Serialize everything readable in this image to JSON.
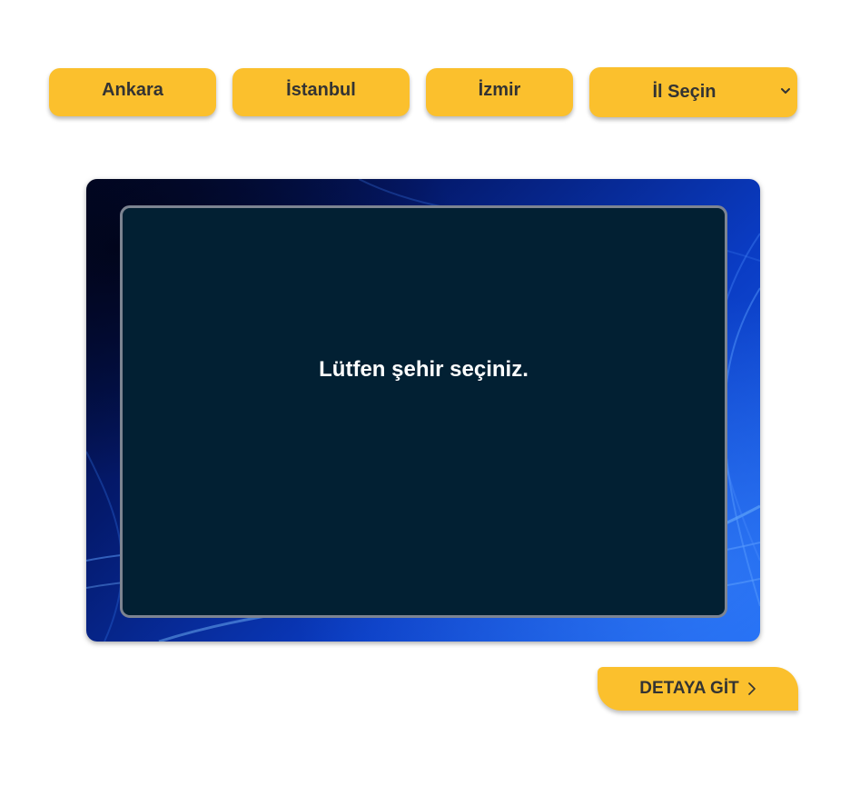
{
  "city_buttons": {
    "ankara": "Ankara",
    "istanbul": "İstanbul",
    "izmir": "İzmir"
  },
  "city_select": {
    "selected": "İl Seçin",
    "icon": "chevron-down-icon"
  },
  "display": {
    "message": "Lütfen şehir seçiniz."
  },
  "detail_button": {
    "label": "DETAYA GİT",
    "icon": "chevron-right-icon"
  },
  "colors": {
    "accent": "#fbc02d",
    "button_text": "#333333",
    "screen_bg": "#022033",
    "screen_border": "#7d8491",
    "frame_blue": "#0a3cc4"
  }
}
